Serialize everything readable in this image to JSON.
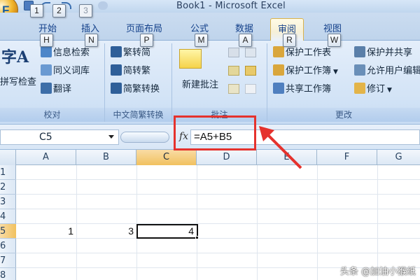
{
  "window": {
    "title": "Book1 - Microsoft Excel",
    "office_button_letter": "F"
  },
  "keytips": {
    "qat": [
      "1",
      "2",
      "3"
    ],
    "tabs": [
      "H",
      "N",
      "P",
      "M",
      "A",
      "R",
      "W"
    ]
  },
  "tabs": [
    {
      "label": "开始"
    },
    {
      "label": "插入"
    },
    {
      "label": "页面布局"
    },
    {
      "label": "公式"
    },
    {
      "label": "数据"
    },
    {
      "label": "审阅",
      "active": true
    },
    {
      "label": "视图"
    }
  ],
  "ribbon": {
    "proofing": {
      "label": "校对",
      "big_icon_text": "字A",
      "spell_check": "拼写检查",
      "research": "信息检索",
      "thesaurus": "同义词库",
      "translate": "翻译"
    },
    "chinese_conversion": {
      "label": "中文简繁转换",
      "to_traditional": "繁转简",
      "to_simplified": "简转繁",
      "convert": "简繁转换"
    },
    "comments": {
      "label": "批注",
      "new_comment": "新建批注"
    },
    "changes": {
      "label": "更改",
      "protect_sheet": "保护工作表",
      "protect_workbook": "保护工作簿",
      "share_workbook": "共享工作簿",
      "protect_and_share": "保护并共享",
      "allow_users": "允许用户编辑",
      "track_changes": "修订"
    }
  },
  "formula_bar": {
    "name_box": "C5",
    "fx_label": "fx",
    "formula": "=A5+B5"
  },
  "grid": {
    "columns": [
      "A",
      "B",
      "C",
      "D",
      "E",
      "F",
      "G"
    ],
    "selected_column": "C",
    "rows": [
      "1",
      "2",
      "3",
      "4",
      "5",
      "6",
      "7",
      "8"
    ],
    "selected_row": "5",
    "cells": {
      "A5": "1",
      "B5": "3",
      "C5": "4"
    }
  },
  "annotation": {
    "color": "#e5322d"
  },
  "watermark": "头条 @加油小猴纸"
}
